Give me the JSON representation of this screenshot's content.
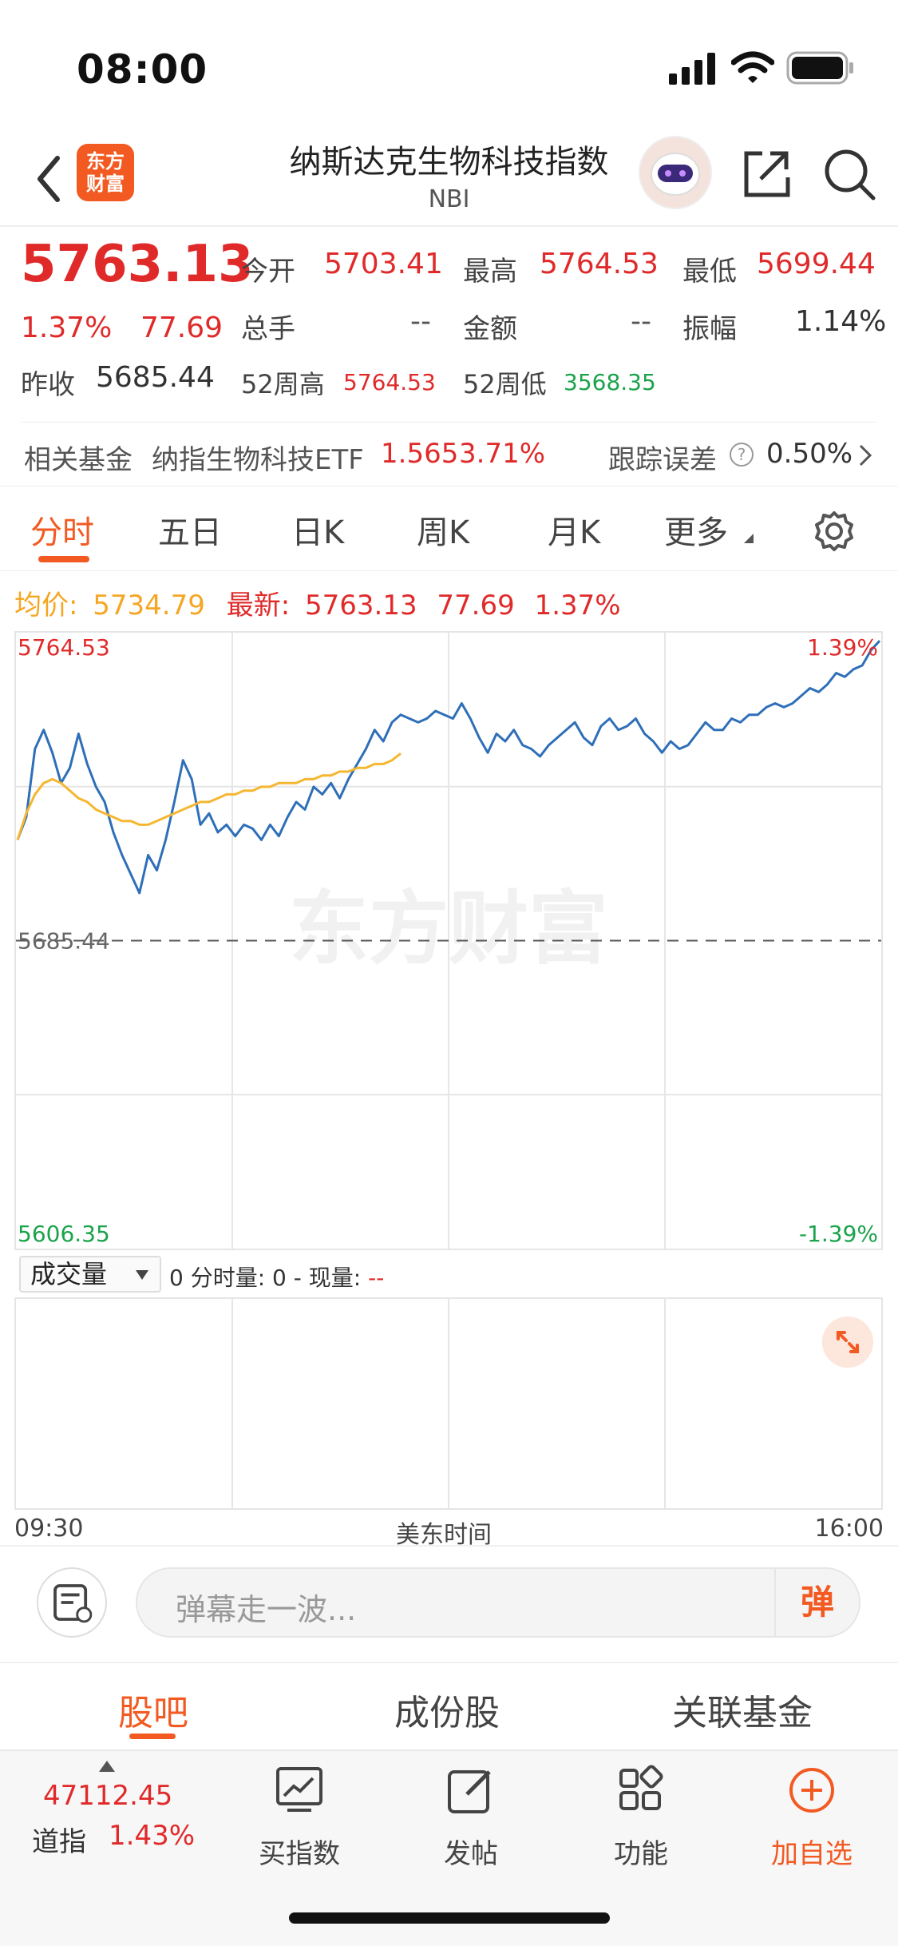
{
  "status_bar": {
    "time": "08:00"
  },
  "header": {
    "logo_text_line1": "东方",
    "logo_text_line2": "财富",
    "title": "纳斯达克生物科技指数",
    "subtitle": "NBI"
  },
  "quote": {
    "price": "5763.13",
    "change_pct": "1.37%",
    "change": "77.69",
    "open_label": "今开",
    "open": "5703.41",
    "high_label": "最高",
    "high": "5764.53",
    "low_label": "最低",
    "low": "5699.44",
    "volume_label": "总手",
    "volume": "--",
    "amount_label": "金额",
    "amount": "--",
    "amplitude_label": "振幅",
    "amplitude": "1.14%",
    "prev_close_label": "昨收",
    "prev_close": "5685.44",
    "w52_high_label": "52周高",
    "w52_high": "5764.53",
    "w52_low_label": "52周低",
    "w52_low": "3568.35"
  },
  "fund": {
    "label": "相关基金",
    "name": "纳指生物科技ETF",
    "price": "1.565",
    "change": "3.71%",
    "tracking_label": "跟踪误差",
    "tracking_value": "0.50%"
  },
  "tabs": [
    "分时",
    "五日",
    "日K",
    "周K",
    "月K",
    "更多"
  ],
  "avg_row": {
    "avg_label": "均价:",
    "avg_value": "5734.79",
    "latest_label": "最新:",
    "latest_value": "5763.13",
    "latest_change": "77.69",
    "latest_pct": "1.37%"
  },
  "chart_data": {
    "type": "line",
    "y_top_label": "5764.53",
    "y_mid_label": "5685.44",
    "y_bottom_label": "5606.35",
    "pct_top_label": "1.39%",
    "pct_bottom_label": "-1.39%",
    "ylim": [
      5606.35,
      5764.53
    ],
    "reference": 5685.44,
    "x_start_label": "09:30",
    "x_mid_label": "美东时间",
    "x_end_label": "16:00",
    "watermark": "东方财富",
    "series": [
      {
        "color": "#2e6fb8",
        "values": [
          5712,
          5718,
          5736,
          5741,
          5735,
          5727,
          5731,
          5740,
          5732,
          5726,
          5722,
          5714,
          5708,
          5703,
          5698,
          5708,
          5704,
          5712,
          5722,
          5733,
          5728,
          5716,
          5719,
          5714,
          5716,
          5713,
          5716,
          5715,
          5712,
          5716,
          5713,
          5718,
          5722,
          5720,
          5726,
          5724,
          5727,
          5723,
          5728,
          5732,
          5736,
          5741,
          5738,
          5743,
          5745,
          5744,
          5743,
          5744,
          5746,
          5745,
          5744,
          5748,
          5744,
          5739,
          5735,
          5740,
          5738,
          5741,
          5737,
          5736,
          5734,
          5737,
          5739,
          5741,
          5743,
          5739,
          5737,
          5742,
          5744,
          5741,
          5742,
          5744,
          5740,
          5738,
          5735,
          5738,
          5736,
          5737,
          5740,
          5743,
          5741,
          5741,
          5744,
          5743,
          5745,
          5745,
          5747,
          5748,
          5747,
          5748,
          5750,
          5752,
          5751,
          5753,
          5756,
          5755,
          5757,
          5758,
          5762,
          5764.5
        ]
      },
      {
        "color": "#f5b731",
        "values": [
          5712,
          5719,
          5724,
          5727,
          5728,
          5727,
          5725,
          5723,
          5722,
          5720,
          5719,
          5718,
          5717,
          5717,
          5716,
          5716,
          5717,
          5718,
          5719,
          5720,
          5721,
          5722,
          5722,
          5723,
          5724,
          5724,
          5725,
          5725,
          5726,
          5726,
          5727,
          5727,
          5727,
          5728,
          5728,
          5729,
          5729,
          5730,
          5730,
          5731,
          5731,
          5732,
          5732,
          5733,
          5734.79
        ]
      }
    ],
    "volume_chart": {
      "selector_label": "成交量",
      "info_text": "0 分时量: 0 - 现量:",
      "current_volume": "--"
    }
  },
  "danmu": {
    "placeholder": "弹幕走一波...",
    "button": "弹"
  },
  "bottom_tabs": [
    "股吧",
    "成份股",
    "关联基金"
  ],
  "nav": {
    "index_value": "47112.45",
    "index_name": "道指",
    "index_pct": "1.43%",
    "items": [
      "买指数",
      "发帖",
      "功能",
      "加自选"
    ]
  }
}
